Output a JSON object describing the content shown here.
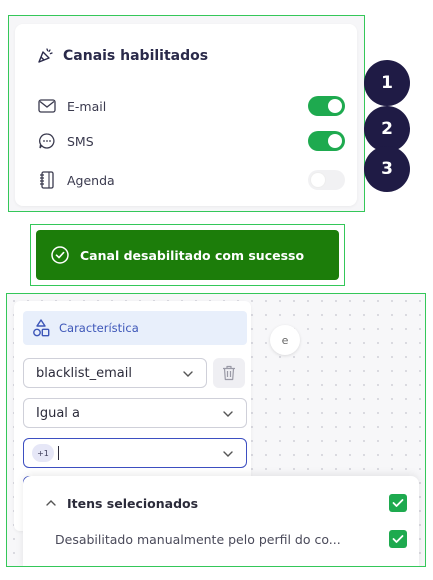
{
  "channels": {
    "title": "Canais habilitados",
    "items": [
      {
        "label": "E-mail",
        "icon": "mail-icon",
        "enabled": true,
        "step": "1"
      },
      {
        "label": "SMS",
        "icon": "chat-bubble-icon",
        "enabled": true,
        "step": "2"
      },
      {
        "label": "Agenda",
        "icon": "notebook-icon",
        "enabled": false,
        "step": "3"
      }
    ]
  },
  "toast": {
    "message": "Canal desabilitado com sucesso",
    "icon": "check-circle-icon"
  },
  "builder": {
    "feature_label": "Característica",
    "attribute_value": "blacklist_email",
    "operator_value": "Igual a",
    "chip_label": "+1",
    "connector_label": "e",
    "selected_section_title": "Itens selecionados",
    "selected_option": "Desabilitado manualmente pelo perfil do co..."
  },
  "colors": {
    "toggle_on": "#1eaa4f",
    "toast_bg": "#1c7d0a",
    "badge_bg": "#1f1b45",
    "accent_blue": "#3d4fc1"
  }
}
